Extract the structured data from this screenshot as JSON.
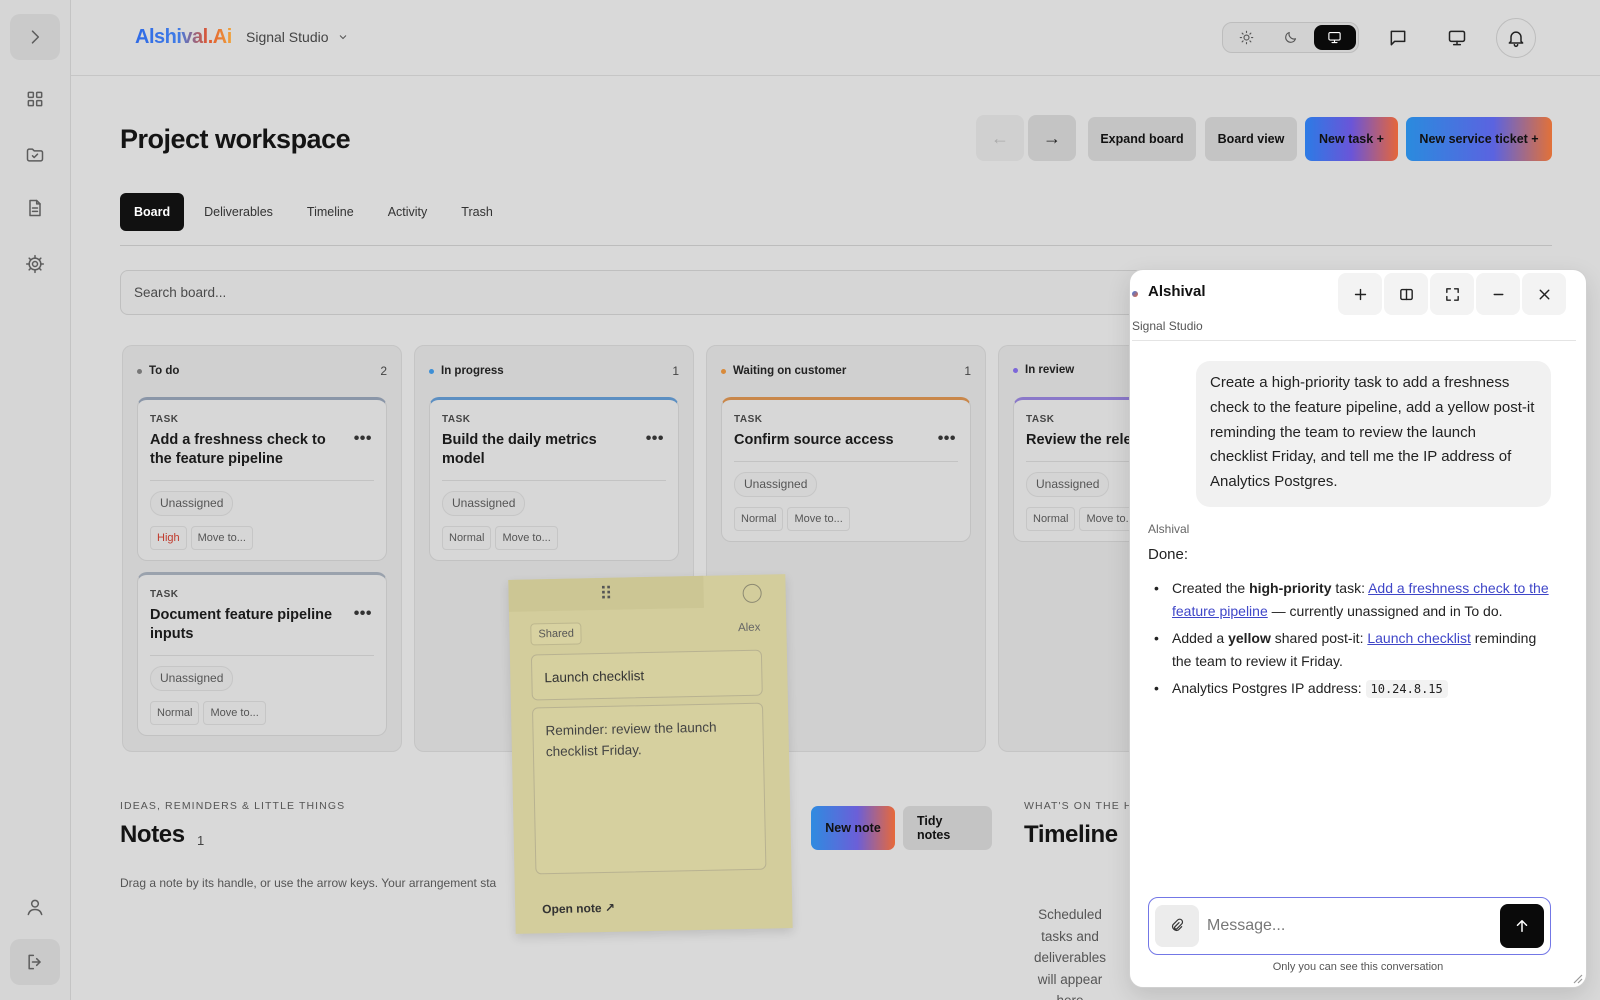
{
  "header": {
    "logo": "Alshival.Ai",
    "workspace": "Signal Studio"
  },
  "page": {
    "title": "Project workspace",
    "prev_label": "←",
    "next_label": "→",
    "buttons": {
      "expand": "Expand board",
      "board_view": "Board view",
      "new_task": "New task +",
      "new_ticket": "New service ticket +"
    }
  },
  "tabs": [
    "Board",
    "Deliverables",
    "Timeline",
    "Activity",
    "Trash"
  ],
  "search": {
    "placeholder": "Search board..."
  },
  "columns": [
    {
      "title": "To do",
      "count": "2",
      "dot": "#777777",
      "cards": [
        {
          "type": "TASK",
          "title": "Add a freshness check to the feature pipeline",
          "assignee": "Unassigned",
          "priority": "High",
          "move": "Move to...",
          "accent": "#8a96a8"
        },
        {
          "type": "TASK",
          "title": "Document feature pipeline inputs",
          "assignee": "Unassigned",
          "priority": "Normal",
          "move": "Move to...",
          "accent": "#9aa2ad"
        }
      ]
    },
    {
      "title": "In progress",
      "count": "1",
      "dot": "#3d8fd6",
      "cards": [
        {
          "type": "TASK",
          "title": "Build the daily metrics model",
          "assignee": "Unassigned",
          "priority": "Normal",
          "move": "Move to...",
          "accent": "#5c8fc2"
        }
      ]
    },
    {
      "title": "Waiting on customer",
      "count": "1",
      "dot": "#d98a3a",
      "cards": [
        {
          "type": "TASK",
          "title": "Confirm source access",
          "assignee": "Unassigned",
          "priority": "Normal",
          "move": "Move to...",
          "accent": "#c9874a"
        }
      ]
    },
    {
      "title": "In review",
      "count": "",
      "dot": "#7c67d9",
      "cards": [
        {
          "type": "TASK",
          "title": "Review the rele",
          "assignee": "Unassigned",
          "priority": "Normal",
          "move": "Move to...",
          "accent": "#8a78c9"
        }
      ]
    }
  ],
  "notes": {
    "kicker": "IDEAS, REMINDERS & LITTLE THINGS",
    "title": "Notes",
    "count": "1",
    "hint": "Drag a note by its handle, or use the arrow keys. Your arrangement sta",
    "new_note": "New note",
    "tidy": "Tidy notes"
  },
  "sticky": {
    "handle": "⠿",
    "shared": "Shared",
    "author": "Alex",
    "title": "Launch checklist",
    "body": "Reminder: review the launch checklist Friday.",
    "open": "Open note ↗",
    "color": "#d3cd9c"
  },
  "timeline": {
    "kicker": "WHAT'S ON THE HO",
    "title": "Timeline",
    "empty": "Scheduled tasks and deliverables will appear here"
  },
  "chat": {
    "name": "Alshival",
    "subtitle": "Signal Studio",
    "user_message": "Create a high-priority task to add a freshness check to the feature pipeline, add a yellow post-it reminding the team to review the launch checklist Friday, and tell me the IP address of Analytics Postgres.",
    "bot_label": "Alshival",
    "bot_lead": "Done:",
    "bullet1": {
      "pre": "Created the ",
      "bold": "high-priority",
      "mid": " task: ",
      "link": "Add a freshness check to the feature pipeline",
      "post": " — currently unassigned and in To do."
    },
    "bullet2": {
      "pre": "Added a ",
      "bold": "yellow",
      "mid": " shared post-it: ",
      "link": "Launch checklist",
      "post": " reminding the team to review it Friday."
    },
    "bullet3": {
      "pre": "Analytics Postgres IP address: ",
      "code": "10.24.8.15"
    },
    "composer_placeholder": "Message...",
    "privacy": "Only you can see this conversation"
  },
  "colors": {
    "accent": "#7377e6",
    "link": "#3f46c8",
    "priority_high": "#c0392b"
  }
}
